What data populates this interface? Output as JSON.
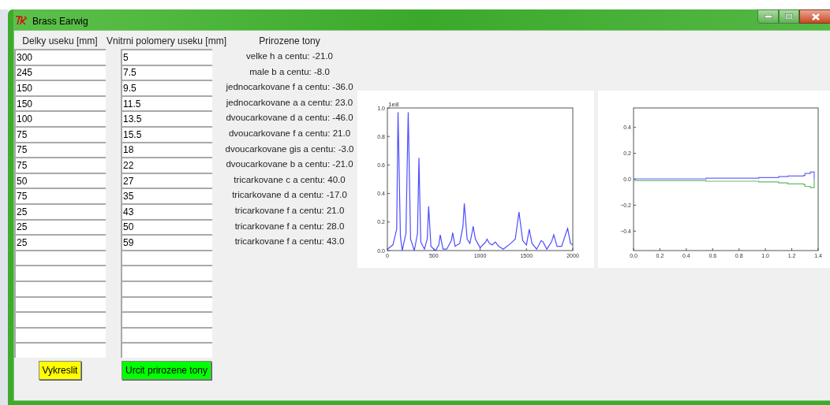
{
  "window": {
    "title": "Brass Earwig"
  },
  "columns": [
    {
      "heading": "Delky useku [mm]",
      "fields": [
        "300",
        "245",
        "150",
        "150",
        "100",
        "75",
        "75",
        "75",
        "50",
        "75",
        "25",
        "25",
        "25"
      ],
      "button": {
        "label": "Vykreslit",
        "color": "#ffff00"
      }
    },
    {
      "heading": "Vnitrni polomery useku [mm]",
      "fields": [
        "5",
        "7.5",
        "9.5",
        "11.5",
        "13.5",
        "15.5",
        "18",
        "22",
        "27",
        "35",
        "43",
        "50",
        "59"
      ],
      "button": {
        "label": "Urcit prirozene tony",
        "color": "#00ff00"
      }
    }
  ],
  "tones": {
    "heading": "Prirozene tony",
    "items": [
      "velke h a centu: -21.0",
      "male b a centu: -8.0",
      "jednocarkovane f a centu: -36.0",
      "jednocarkovane a a centu: 23.0",
      "dvoucarkovane d a centu: -46.0",
      "dvoucarkovane f a centu: 21.0",
      "dvoucarkovane gis a centu: -3.0",
      "dvoucarkovane b a centu: -21.0",
      "tricarkovane c a centu: 40.0",
      "tricarkovane d a centu: -17.0",
      "tricarkovane f a centu: 21.0",
      "tricarkovane f a centu: 28.0",
      "tricarkovane f a centu: 43.0"
    ]
  },
  "charts": [
    {
      "chart_data": {
        "type": "line",
        "x": [
          0,
          60,
          100,
          115,
          140,
          160,
          200,
          225,
          250,
          290,
          325,
          340,
          360,
          400,
          430,
          445,
          470,
          520,
          555,
          570,
          600,
          640,
          690,
          705,
          730,
          780,
          815,
          830,
          860,
          890,
          915,
          925,
          950,
          1000,
          1060,
          1075,
          1100,
          1130,
          1165,
          1200,
          1250,
          1330,
          1380,
          1420,
          1460,
          1500,
          1530,
          1560,
          1610,
          1660,
          1680,
          1720,
          1770,
          1795,
          1830,
          1880,
          1930,
          1945,
          1975,
          2000
        ],
        "series": [
          {
            "color": "#4d4dff",
            "values": [
              0.01,
              0.04,
              0.15,
              0.97,
              0.1,
              0.0,
              0.12,
              0.97,
              0.08,
              0.0,
              0.12,
              0.65,
              0.06,
              0.01,
              0.08,
              0.31,
              0.03,
              0.0,
              0.04,
              0.11,
              0.01,
              0.01,
              0.07,
              0.125,
              0.03,
              0.05,
              0.17,
              0.33,
              0.08,
              0.05,
              0.13,
              0.17,
              0.08,
              0.02,
              0.06,
              0.08,
              0.05,
              0.04,
              0.06,
              0.03,
              0.01,
              0.05,
              0.08,
              0.27,
              0.07,
              0.04,
              0.15,
              0.05,
              0.01,
              0.07,
              0.06,
              0.01,
              0.06,
              0.11,
              0.03,
              0.03,
              0.13,
              0.155,
              0.05,
              0.04
            ]
          }
        ],
        "xlim": [
          0,
          2000
        ],
        "ylim": [
          0,
          1.0
        ],
        "xticks": [
          0,
          500,
          1000,
          1500,
          2000
        ],
        "yticks": [
          {
            "value": 0,
            "label": "0.0"
          },
          {
            "value": 0.2,
            "label": "0.2"
          },
          {
            "value": 0.4,
            "label": "0.4"
          },
          {
            "value": 0.6,
            "label": "0.6"
          },
          {
            "value": 0.8,
            "label": "0.8"
          },
          {
            "value": 1.0,
            "label": "1.0"
          }
        ],
        "annotations": [
          "1e8"
        ]
      }
    },
    {
      "chart_data": {
        "type": "line",
        "x": [
          0,
          0.55,
          0.55,
          0.95,
          0.95,
          1.1,
          1.1,
          1.17,
          1.17,
          1.29,
          1.29,
          1.3,
          1.3,
          1.34,
          1.34,
          1.37,
          1.37
        ],
        "series": [
          {
            "color": "#6666ff",
            "values": [
              0.003,
              0.003,
              0.008,
              0.008,
              0.013,
              0.013,
              0.02,
              0.02,
              0.025,
              0.025,
              0.03,
              0.03,
              0.045,
              0.045,
              0.055,
              0.055,
              0
            ]
          },
          {
            "color": "#66bb66",
            "values": [
              -0.01,
              -0.01,
              -0.015,
              -0.015,
              -0.02,
              -0.02,
              -0.028,
              -0.028,
              -0.035,
              -0.035,
              -0.04,
              -0.04,
              -0.055,
              -0.055,
              -0.065,
              -0.065,
              0
            ]
          }
        ],
        "xlim": [
          0,
          1.4
        ],
        "ylim": [
          -0.55,
          0.55
        ],
        "xticks": [
          {
            "value": 0,
            "label": "0.0"
          },
          {
            "value": 0.2,
            "label": "0.2"
          },
          {
            "value": 0.4,
            "label": "0.4"
          },
          {
            "value": 0.6,
            "label": "0.6"
          },
          {
            "value": 0.8,
            "label": "0.8"
          },
          {
            "value": 1.0,
            "label": "1.0"
          },
          {
            "value": 1.2,
            "label": "1.2"
          },
          {
            "value": 1.4,
            "label": "1.4"
          }
        ],
        "yticks": [
          {
            "value": -0.4,
            "label": "−0.4"
          },
          {
            "value": -0.2,
            "label": "−0.2"
          },
          {
            "value": 0,
            "label": "0.0"
          },
          {
            "value": 0.2,
            "label": "0.2"
          },
          {
            "value": 0.4,
            "label": "0.4"
          }
        ]
      }
    }
  ]
}
